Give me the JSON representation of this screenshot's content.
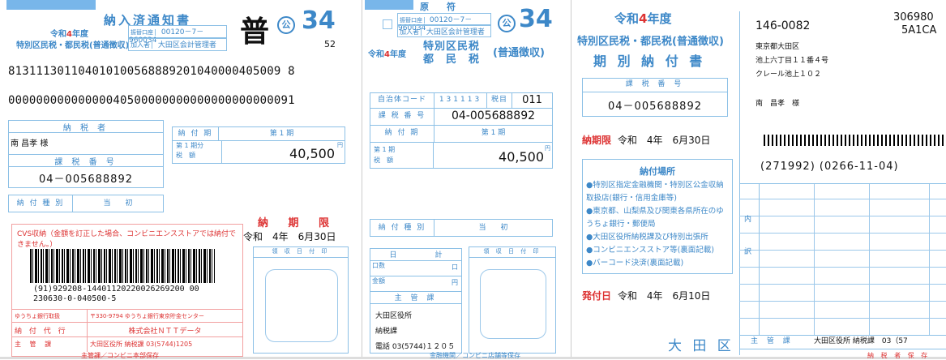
{
  "slip1": {
    "title": "納入済通知書",
    "era": "令和",
    "year": "4",
    "nendo": "年度",
    "tax_name": "特別区民税・都民税(普通徴収)",
    "account_label": "振替口座",
    "account": "00120－7－960034",
    "member_label": "加入者",
    "member": "大田区会計管理者",
    "futsu": "普",
    "ko": "公",
    "num": "34",
    "sub_num": "52",
    "ocr_line1": "813111301104010100568889201040000405009 8",
    "ocr_line2": "00000000000000040500000000000000000000091",
    "taxpayer_header": "納 税 者",
    "taxpayer_name": "南 昌孝 様",
    "taxno_label": "課 税 番 号",
    "taxno": "04－005688892",
    "period_label": "納 付 期",
    "period": "第 1 期",
    "amount_label1": "第 1 期分",
    "amount_label2": "税　額",
    "amount": "40,500",
    "yen": "円",
    "kind_label": "納 付 種 別",
    "kind": "当　　初",
    "deadline_label": "納 期 限",
    "deadline": "令和　4年　6月30日",
    "cvs_note": "CVS収納（金額を訂正した場合、コンビニエンスストアでは納付できません。）",
    "bc_num1": "(91)929208-14401120220026269200 00",
    "bc_num2": "230630-0-040500-5",
    "bank_label": "ゆうちょ銀行取扱",
    "bank_addr": "〒330-9794 ゆうちょ銀行東京貯金センター",
    "agent_label": "納 付 代 行",
    "agent": "株式会社ＮＴＴデータ",
    "dept_label": "主 管 課",
    "dept": "大田区役所 納税課 03(5744)1205",
    "stamp_label": "領 収 日 付 印",
    "footer": "主管課／コンビニ本部保存"
  },
  "slip2": {
    "head": "原　　符",
    "account_label": "振替口座",
    "account": "00120－7－960034",
    "member_label": "加入者",
    "member": "大田区会計管理者",
    "era": "令和",
    "year": "4",
    "nendo": "年度",
    "tax1": "特別区民税",
    "tax2": "都　民　税",
    "tax3": "(普通徴収)",
    "ko": "公",
    "num": "34",
    "muni_label": "自治体コード",
    "muni": "131113",
    "taxcode_label": "税目",
    "taxcode": "011",
    "taxno_label": "課 税 番 号",
    "taxno": "04-005688892",
    "period_label": "納 付 期",
    "period": "第 1 期",
    "amount_label1": "第 1 期",
    "amount_label2": "税　額",
    "amount": "40,500",
    "yen": "円",
    "kind_label": "納 付 種 別",
    "kind": "当　　初",
    "day_label": "日",
    "total_label": "計",
    "count_label": "口数",
    "count_unit": "口",
    "sum_label": "金額",
    "sum_unit": "円",
    "dept_label": "主 管 課",
    "office": "大田区役所",
    "section": "納税課",
    "tel": "電話 03(5744)１２０５",
    "stamp_label": "領 収 日 付 印",
    "footer": "金融機関／コンビニ店舗等保存"
  },
  "slip3": {
    "era": "令和",
    "year": "4",
    "nendo": "年度",
    "tax": "特別区民税・都民税(普通徴収)",
    "title": "期 別 納 付 書",
    "taxno_label": "課 税 番 号",
    "taxno": "04－005688892",
    "deadline_label": "納期限",
    "deadline": "令和　4年　6月30日",
    "places_title": "納付場所",
    "places": [
      "●特別区指定金融機関・特別区公金収納取扱店(銀行・信用金庫等)",
      "●東京都、山梨県及び関東各県所在のゆうちょ銀行・郵便局",
      "●大田区役所納税課及び特別出張所",
      "●コンビニエンスストア等(裏面記載)",
      "●バーコード決済(裏面記載)"
    ],
    "issue_label": "発付日",
    "issue": "令和　4年　6月10日",
    "city": "大 田 区"
  },
  "slip4": {
    "zip": "146-0082",
    "code1": "306980",
    "code2": "5A1CA",
    "addr1": "東京都大田区",
    "addr2": "池上六丁目１１番４号",
    "addr3": "クレール池上１０２",
    "name": "南　昌孝　様",
    "numbers": "(271992)  (0266-11-04)",
    "uchi": "内",
    "wake": "訳",
    "dept_label": "主 管 課",
    "dept": "大田区役所 納税課　03（57",
    "footer": "納 税 者 保 存"
  }
}
